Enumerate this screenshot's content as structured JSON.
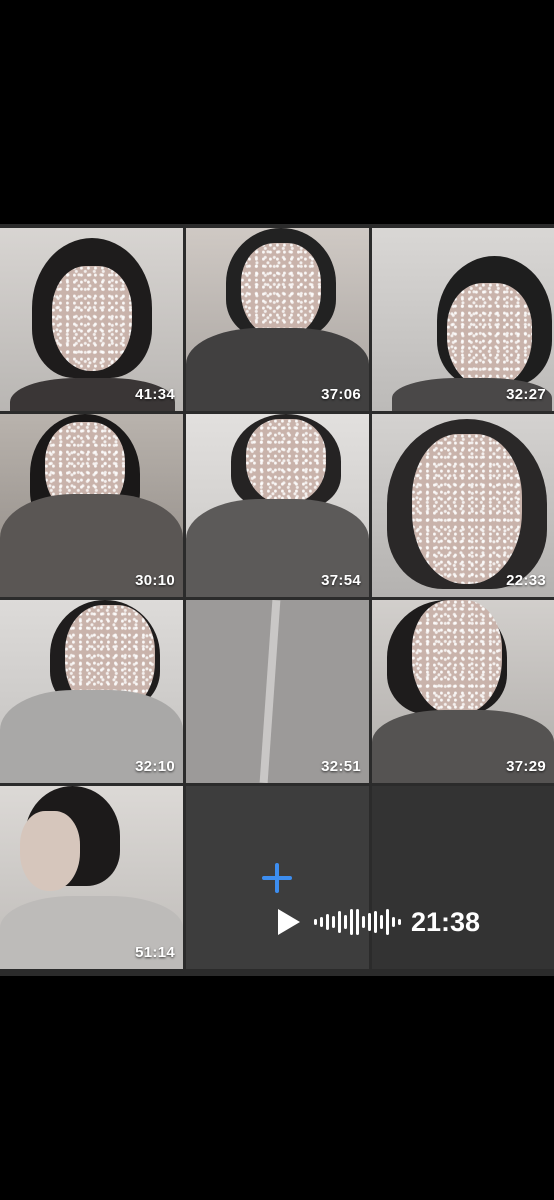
{
  "gallery": {
    "tiles": [
      {
        "duration": "41:34"
      },
      {
        "duration": "37:06"
      },
      {
        "duration": "32:27"
      },
      {
        "duration": "30:10"
      },
      {
        "duration": "37:54"
      },
      {
        "duration": "22:33"
      },
      {
        "duration": "32:10"
      },
      {
        "duration": "32:51"
      },
      {
        "duration": "37:29"
      },
      {
        "duration": "51:14"
      }
    ]
  },
  "voice_message": {
    "duration": "21:38",
    "play_icon": "play-icon"
  },
  "add_button": {
    "icon": "plus-icon",
    "color": "#3d8ef0"
  }
}
